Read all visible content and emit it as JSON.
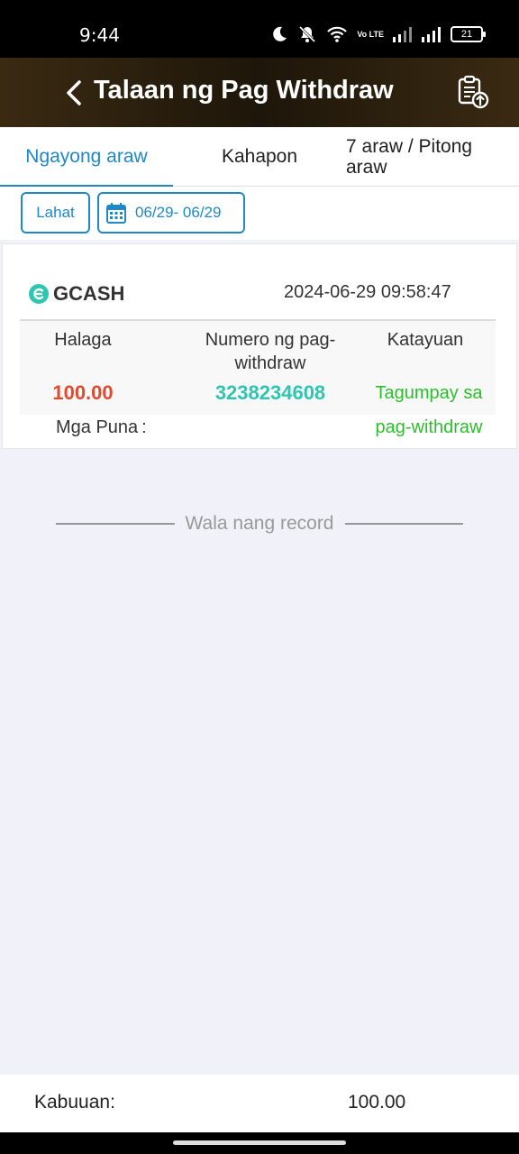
{
  "status_bar": {
    "time": "9:44",
    "battery": "21",
    "network_label": "Vo LTE"
  },
  "header": {
    "title": "Talaan ng Pag Withdraw"
  },
  "tabs": [
    {
      "label": "Ngayong araw",
      "active": true
    },
    {
      "label": "Kahapon",
      "active": false
    },
    {
      "label": "7 araw / Pitong araw",
      "active": false
    }
  ],
  "filters": {
    "all_label": "Lahat",
    "date_range": "06/29- 06/29"
  },
  "record": {
    "method": "GCASH",
    "datetime": "2024-06-29 09:58:47",
    "amount_label": "Halaga",
    "number_label": "Numero ng pag-withdraw",
    "status_label": "Katayuan",
    "amount": "100.00",
    "withdraw_number": "3238234608",
    "status": "Tagumpay sa pag-withdraw",
    "remarks_label": "Mga Puna",
    "remarks_sep": ":"
  },
  "no_more_records": "Wala nang record",
  "footer": {
    "total_label": "Kabuuan:",
    "total_value": "100.00"
  },
  "colors": {
    "accent": "#1e88c8",
    "amount": "#e04a2e",
    "number": "#2ec6b0",
    "status": "#2bbf2b",
    "header_bg": "#2a1f0e"
  }
}
